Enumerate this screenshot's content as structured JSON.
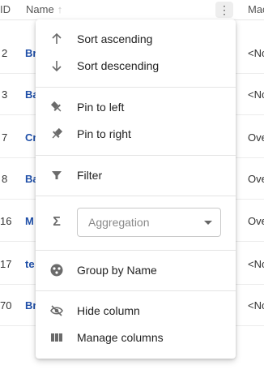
{
  "header": {
    "id_label": "ID",
    "name_label": "Name",
    "mac_label": "Mac",
    "sort_icon": "arrow-up-icon",
    "menu_icon": "more-vert-icon"
  },
  "rows": [
    {
      "id": "2",
      "name": "Br",
      "mac": "<No"
    },
    {
      "id": "3",
      "name": "Ba",
      "mac": "<No"
    },
    {
      "id": "7",
      "name": "Cr",
      "mac": "Ove"
    },
    {
      "id": "8",
      "name": "Ba",
      "mac": "Ove"
    },
    {
      "id": "16",
      "name": "M",
      "mac": "Ove"
    },
    {
      "id": "17",
      "name": "te",
      "mac": "<No"
    },
    {
      "id": "70",
      "name": "Br",
      "mac": "<No"
    }
  ],
  "menu": {
    "sort_asc": "Sort ascending",
    "sort_desc": "Sort descending",
    "pin_left": "Pin to left",
    "pin_right": "Pin to right",
    "filter": "Filter",
    "aggregation_placeholder": "Aggregation",
    "group_by": "Group by Name",
    "hide_column": "Hide column",
    "manage_columns": "Manage columns"
  },
  "colors": {
    "link": "#1f4fa8",
    "icon": "#6b6b6b"
  }
}
